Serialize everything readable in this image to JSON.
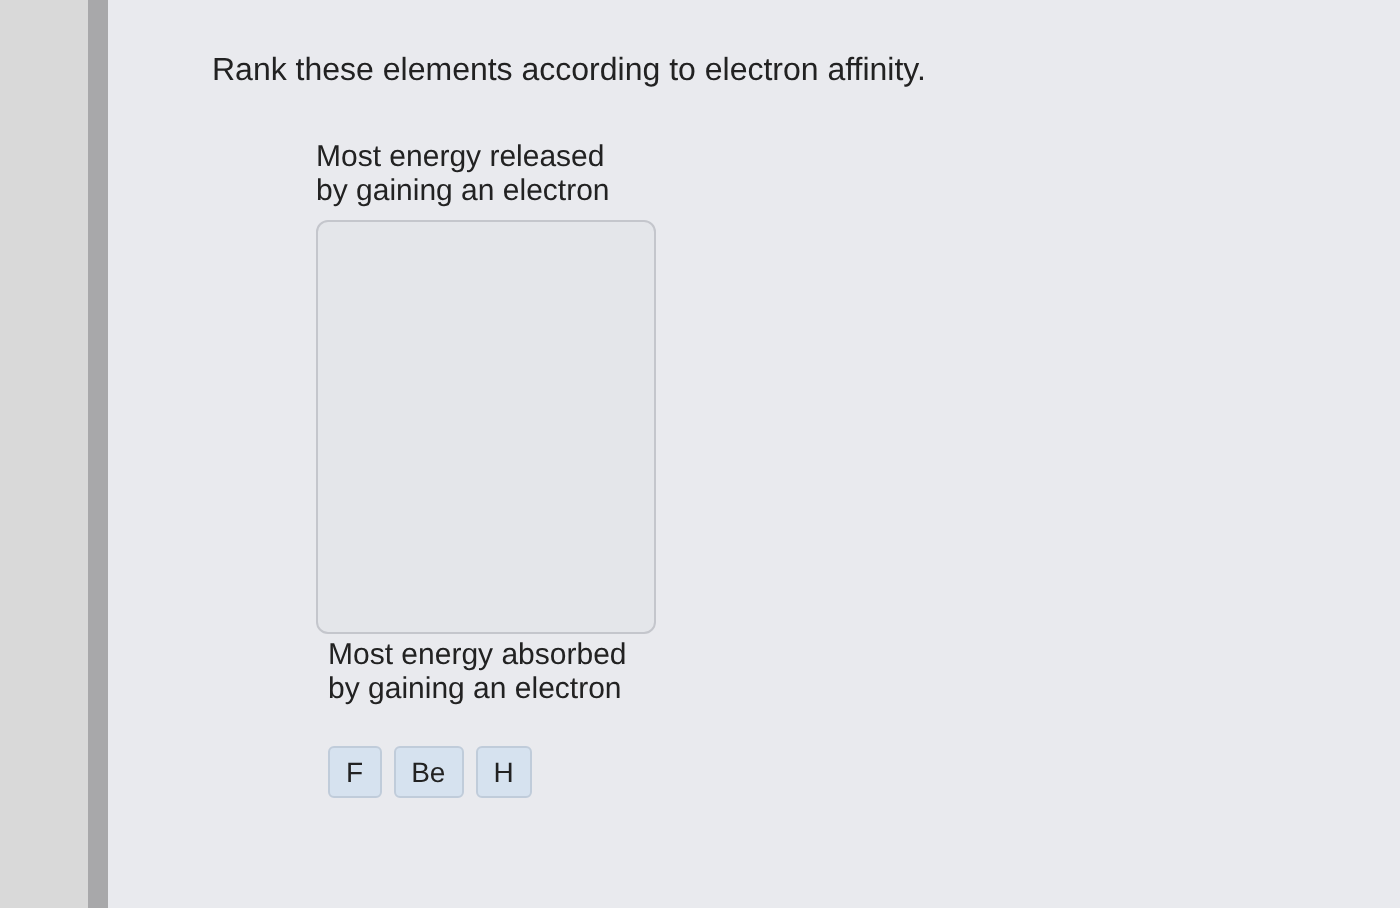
{
  "question": "Rank these elements according to electron affinity.",
  "top_label": "Most energy released by gaining an electron",
  "bottom_label": "Most energy absorbed by gaining an electron",
  "items": [
    {
      "label": "F"
    },
    {
      "label": "Be"
    },
    {
      "label": "H"
    }
  ]
}
